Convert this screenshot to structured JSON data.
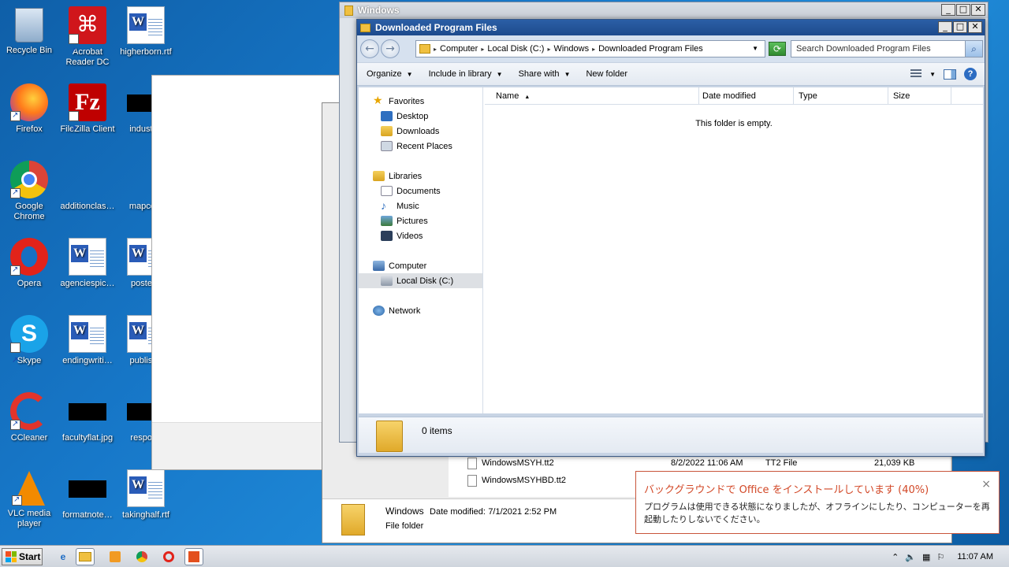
{
  "desktop": {
    "icons": [
      {
        "label": "Recycle Bin",
        "icon": "recycle-bin-icon"
      },
      {
        "label": "Acrobat Reader DC",
        "icon": "acrobat-icon"
      },
      {
        "label": "higherborn.rtf",
        "icon": "word-doc-icon"
      },
      {
        "label": "Firefox",
        "icon": "firefox-icon"
      },
      {
        "label": "FileZilla Client",
        "icon": "filezilla-icon"
      },
      {
        "label": "industria",
        "icon": "black-thumb-icon"
      },
      {
        "label": "Google Chrome",
        "icon": "chrome-icon"
      },
      {
        "label": "additionclas…",
        "icon": "blank-icon"
      },
      {
        "label": "mapcom",
        "icon": "blank-icon"
      },
      {
        "label": "Opera",
        "icon": "opera-icon"
      },
      {
        "label": "agenciespic…",
        "icon": "word-doc-icon"
      },
      {
        "label": "postedli",
        "icon": "word-doc-icon"
      },
      {
        "label": "Skype",
        "icon": "skype-icon"
      },
      {
        "label": "endingwriti…",
        "icon": "word-doc-icon"
      },
      {
        "label": "publishe",
        "icon": "word-doc-icon"
      },
      {
        "label": "CCleaner",
        "icon": "ccleaner-icon"
      },
      {
        "label": "facultyflat.jpg",
        "icon": "black-thumb-icon"
      },
      {
        "label": "respons",
        "icon": "black-thumb-icon"
      },
      {
        "label": "VLC media player",
        "icon": "vlc-icon"
      },
      {
        "label": "formatnote…",
        "icon": "black-thumb-icon"
      },
      {
        "label": "takinghalf.rtf",
        "icon": "word-doc-icon"
      }
    ]
  },
  "windows_window": {
    "title": "Windows"
  },
  "main_window": {
    "title": "Downloaded Program Files",
    "breadcrumbs": [
      "Computer",
      "Local Disk (C:)",
      "Windows",
      "Downloaded Program Files"
    ],
    "search_placeholder": "Search Downloaded Program Files",
    "toolbar": {
      "organize": "Organize",
      "include": "Include in library",
      "share": "Share with",
      "new_folder": "New folder"
    },
    "nav": {
      "favorites": "Favorites",
      "desktop": "Desktop",
      "downloads": "Downloads",
      "recent": "Recent Places",
      "libraries": "Libraries",
      "documents": "Documents",
      "music": "Music",
      "pictures": "Pictures",
      "videos": "Videos",
      "computer": "Computer",
      "local_disk": "Local Disk (C:)",
      "network": "Network"
    },
    "columns": [
      "Name",
      "Date modified",
      "Type",
      "Size"
    ],
    "empty_message": "This folder is empty.",
    "item_count": "0 items"
  },
  "background_window": {
    "files": [
      {
        "name": "WindowsMSYH.tt2",
        "date": "8/2/2022 11:06 AM",
        "type": "TT2 File",
        "size": "21,039 KB"
      },
      {
        "name": "WindowsMSYHBD.tt2",
        "date": "",
        "type": "",
        "size": ""
      }
    ],
    "details": {
      "name": "Windows",
      "date_label": "Date modified:",
      "date": "7/1/2021 2:52 PM",
      "type": "File folder"
    }
  },
  "notification": {
    "title": "バックグラウンドで Office をインストールしています (40%)",
    "body": "プログラムは使用できる状態になりましたが、オフラインにしたり、コンピューターを再起動したりしないでください。",
    "close": "×"
  },
  "taskbar": {
    "start_label": "Start",
    "clock": "11:07 AM"
  }
}
